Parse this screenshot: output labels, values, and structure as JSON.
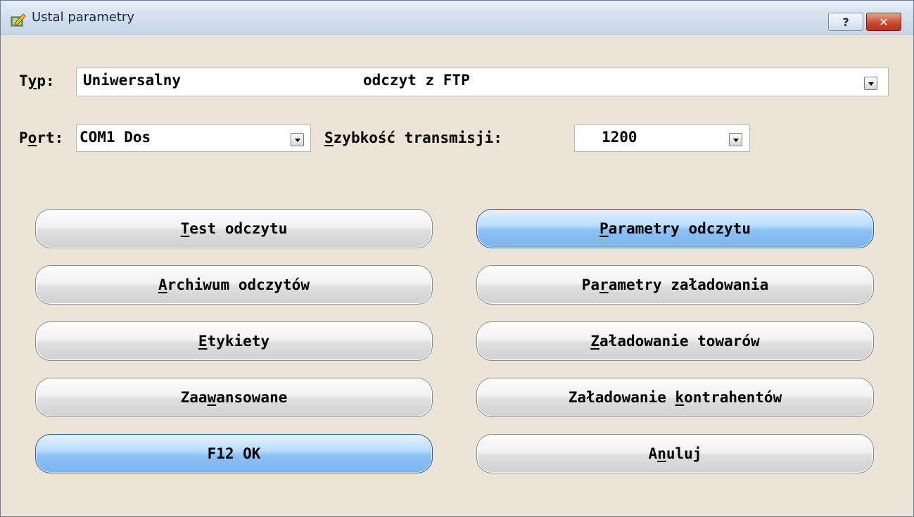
{
  "window": {
    "title": "Ustal parametry",
    "help_label": "?",
    "close_label": "✕"
  },
  "typ": {
    "label_pre": "T",
    "label_u": "y",
    "label_post": "p:",
    "value_left": "Uniwersalny",
    "value_right": "odczyt z FTP"
  },
  "port": {
    "label_pre": "P",
    "label_u": "o",
    "label_post": "rt:",
    "value": "COM1 Dos"
  },
  "speed": {
    "label_u": "S",
    "label_post": "zybkość transmisji:",
    "value": "1200"
  },
  "buttons": {
    "test": {
      "pre": "",
      "u": "T",
      "post": "est odczytu"
    },
    "params": {
      "pre": "",
      "u": "P",
      "post": "arametry odczytu"
    },
    "archive": {
      "pre": "",
      "u": "A",
      "post": "rchiwum odczytów"
    },
    "load_params": {
      "pre": "Pa",
      "u": "r",
      "post": "ametry załadowania"
    },
    "labels": {
      "pre": "",
      "u": "E",
      "post": "tykiety"
    },
    "load_goods": {
      "pre": "",
      "u": "Z",
      "post": "aładowanie towarów"
    },
    "advanced": {
      "pre": "Zaa",
      "u": "w",
      "post": "ansowane"
    },
    "load_contr": {
      "pre": "Załadowanie ",
      "u": "k",
      "post": "ontrahentów"
    },
    "ok": {
      "label": "F12 OK"
    },
    "cancel": {
      "pre": "A",
      "u": "n",
      "post": "uluj"
    }
  },
  "colors": {
    "window_bg": "#ece4d7",
    "highlight_button": "#8dc1f5",
    "close_button": "#c9452c"
  },
  "icons": {
    "title": "pencil-ruler-icon",
    "dropdown": "chevron-down-icon"
  }
}
